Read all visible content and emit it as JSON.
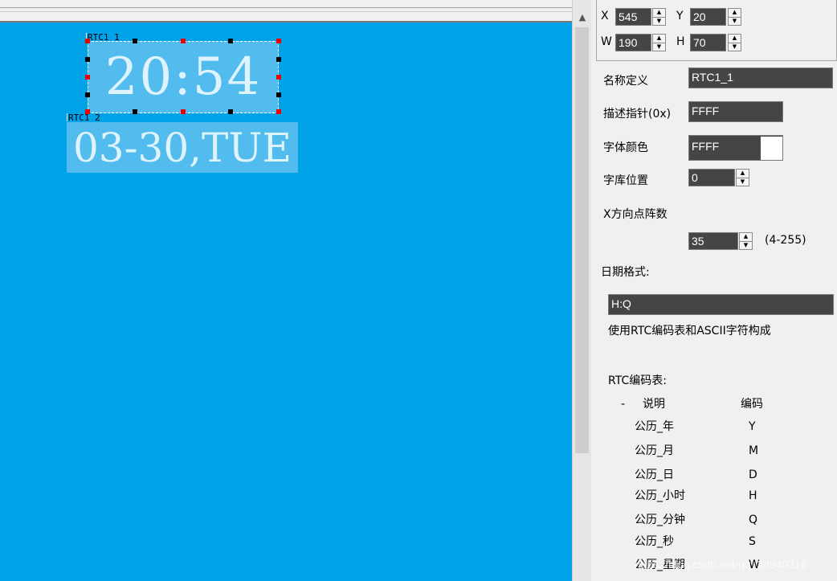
{
  "canvas": {
    "widgets": [
      {
        "name": "RTC1_1",
        "text": "20:54"
      },
      {
        "name": "RTC1_2",
        "text": "03-30,TUE"
      }
    ]
  },
  "panel": {
    "x_label": "X",
    "x_value": "545",
    "y_label": "Y",
    "y_value": "20",
    "w_label": "W",
    "w_value": "190",
    "h_label": "H",
    "h_value": "70",
    "name_label": "名称定义",
    "name_value": "RTC1_1",
    "desc_ptr_label": "描述指针(0x)",
    "desc_ptr_value": "FFFF",
    "font_color_label": "字体颜色",
    "font_color_value": "FFFF",
    "font_lib_label": "字库位置",
    "font_lib_value": "0",
    "x_dots_label": "X方向点阵数",
    "x_dots_value": "35",
    "x_dots_range": "(4-255)",
    "date_format_label": "日期格式:",
    "date_format_value": "H:Q",
    "date_format_hint": "使用RTC编码表和ASCII字符构成",
    "rtc_table": {
      "title": "RTC编码表:",
      "col_desc": "说明",
      "col_code": "编码",
      "dash": "-",
      "rows": [
        {
          "desc": "公历_年",
          "code": "Y"
        },
        {
          "desc": "公历_月",
          "code": "M"
        },
        {
          "desc": "公历_日",
          "code": "D"
        },
        {
          "desc": "公历_小时",
          "code": "H"
        },
        {
          "desc": "公历_分钟",
          "code": "Q"
        },
        {
          "desc": "公历_秒",
          "code": "S"
        },
        {
          "desc": "公历_星期",
          "code": "W"
        }
      ]
    }
  },
  "watermark": "https://blog.csdn.net/qq_38940316",
  "colors": {
    "canvas": "#00a2e8",
    "widget": "#53bcee",
    "field": "#454545",
    "handle_red": "#ee0000"
  }
}
